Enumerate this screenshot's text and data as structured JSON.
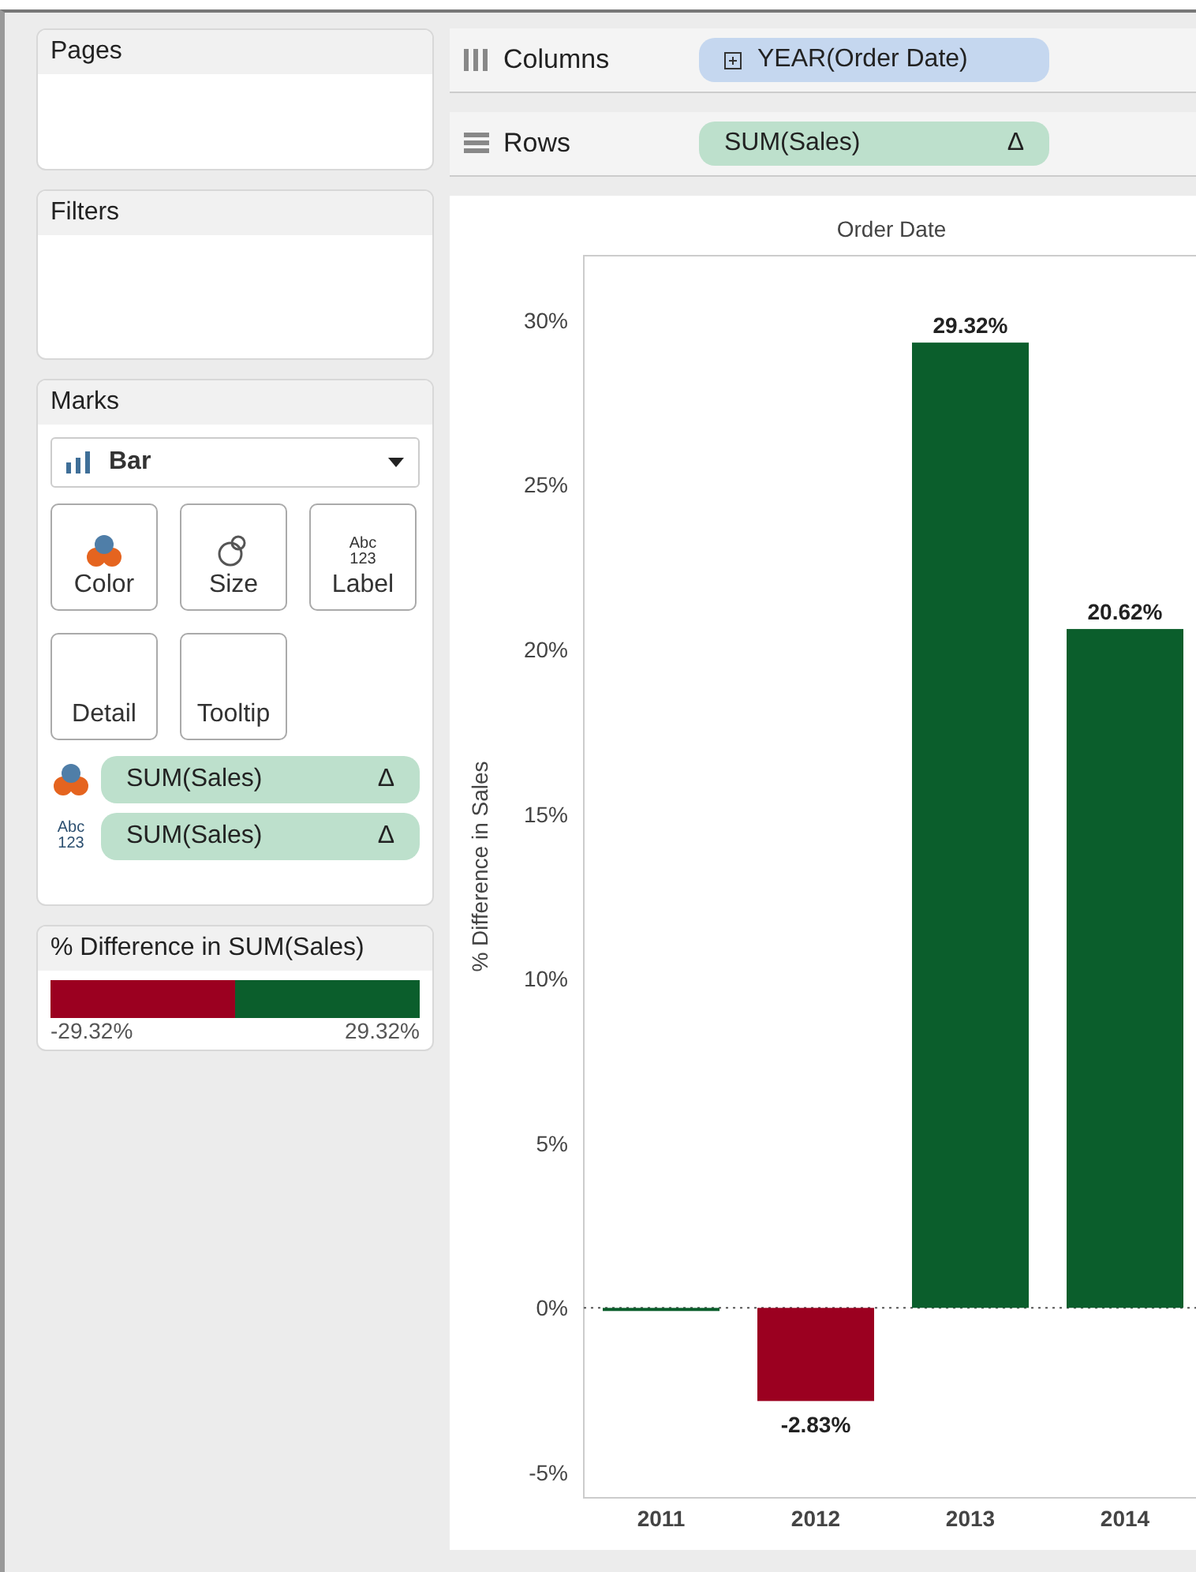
{
  "pages_card": {
    "title": "Pages"
  },
  "filters_card": {
    "title": "Filters"
  },
  "marks_card": {
    "title": "Marks",
    "mark_type": "Bar",
    "buttons": [
      {
        "kind": "color",
        "label": "Color"
      },
      {
        "kind": "size",
        "label": "Size"
      },
      {
        "kind": "label",
        "label": "Label",
        "icon_lines": [
          "Abc",
          "123"
        ]
      },
      {
        "kind": "detail",
        "label": "Detail"
      },
      {
        "kind": "tooltip",
        "label": "Tooltip"
      }
    ],
    "fields": [
      {
        "kind": "color",
        "pill": "SUM(Sales)",
        "delta": "Δ"
      },
      {
        "kind": "label",
        "icon_lines": [
          "Abc",
          "123"
        ],
        "pill": "SUM(Sales)",
        "delta": "Δ"
      }
    ]
  },
  "legend": {
    "title": "% Difference in SUM(Sales)",
    "min_label": "-29.32%",
    "max_label": "29.32%"
  },
  "shelves": [
    {
      "kind": "columns",
      "label": "Columns",
      "pill": "YEAR(Order Date)",
      "expand_icon": true
    },
    {
      "kind": "rows",
      "label": "Rows",
      "pill": "SUM(Sales)",
      "delta": "Δ"
    }
  ],
  "chart": {
    "chart_data": {
      "type": "bar",
      "title": "Order Date",
      "ylabel": "% Difference in Sales",
      "categories": [
        "2011",
        "2012",
        "2013",
        "2014"
      ],
      "values": [
        0,
        -2.83,
        29.32,
        20.62
      ],
      "value_labels": [
        null,
        "-2.83%",
        "29.32%",
        "20.62%"
      ],
      "ylim": [
        -5.77,
        31.96
      ],
      "yticks": [
        {
          "value": -5,
          "label": "-5%"
        },
        {
          "value": 0,
          "label": "0%"
        },
        {
          "value": 5,
          "label": "5%"
        },
        {
          "value": 10,
          "label": "10%"
        },
        {
          "value": 15,
          "label": "15%"
        },
        {
          "value": 20,
          "label": "20%"
        },
        {
          "value": 25,
          "label": "25%"
        },
        {
          "value": 30,
          "label": "30%"
        }
      ]
    }
  }
}
